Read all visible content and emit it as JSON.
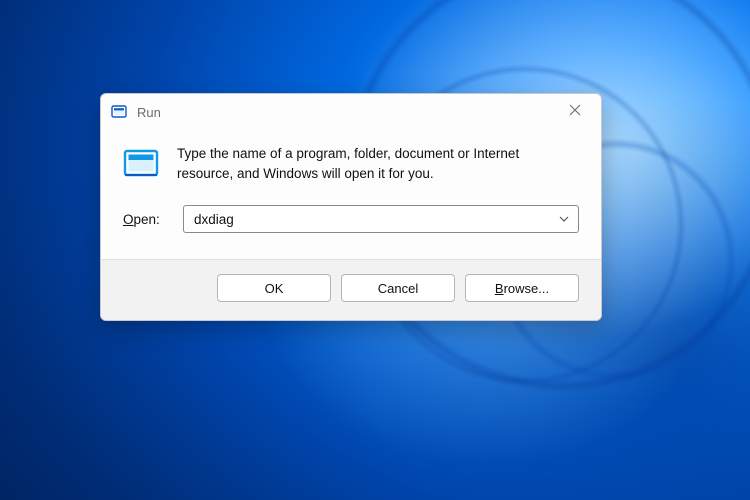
{
  "dialog": {
    "title": "Run",
    "description": "Type the name of a program, folder, document or Internet resource, and Windows will open it for you.",
    "open_label_prefix": "O",
    "open_label_rest": "pen:",
    "input_value": "dxdiag",
    "buttons": {
      "ok": "OK",
      "cancel": "Cancel",
      "browse_prefix": "B",
      "browse_rest": "rowse..."
    }
  }
}
